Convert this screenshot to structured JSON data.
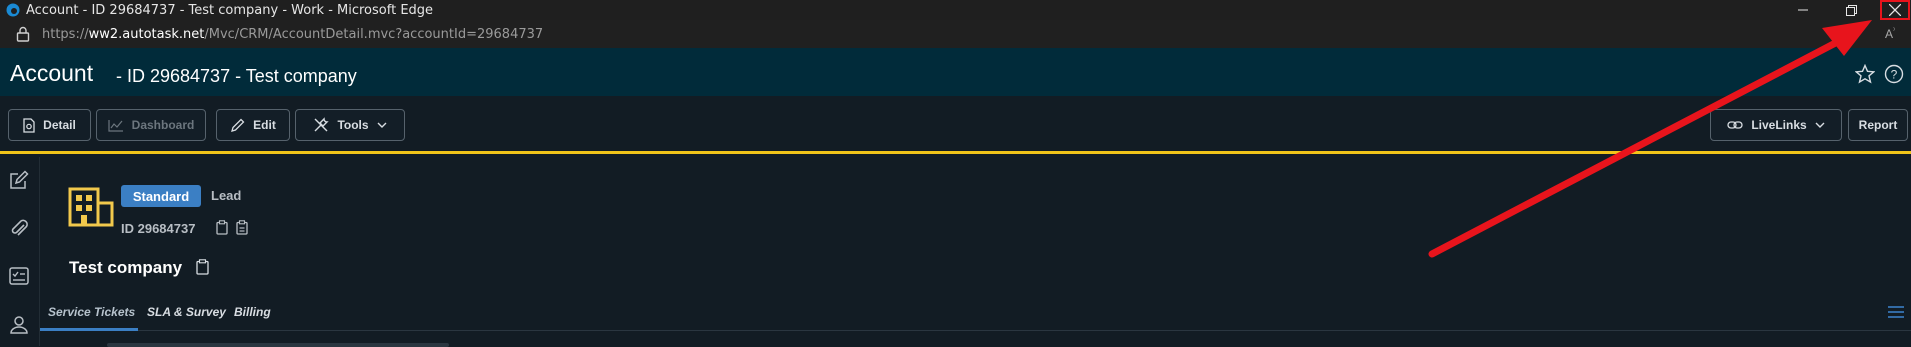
{
  "window": {
    "title": "Account - ID 29684737 - Test company - Work - Microsoft Edge"
  },
  "address": {
    "prefix": "https://",
    "domain": "ww2.autotask.net",
    "path": "/Mvc/CRM/AccountDetail.mvc?accountId=29684737",
    "read_aloud_label": "A"
  },
  "header": {
    "title": "Account",
    "subtitle": "- ID 29684737 - Test company"
  },
  "toolbar": {
    "detail": "Detail",
    "dashboard": "Dashboard",
    "edit": "Edit",
    "tools": "Tools",
    "livelinks": "LiveLinks",
    "report": "Report"
  },
  "account": {
    "badge": "Standard",
    "type": "Lead",
    "id_text": "ID 29684737",
    "name": "Test company"
  },
  "tabs": [
    "Service Tickets",
    "SLA & Survey",
    "Billing"
  ],
  "colors": {
    "accent": "#3b7fc4",
    "divider": "#f0c419",
    "annotation": "#e8141c",
    "header_bg": "#012b3a"
  }
}
